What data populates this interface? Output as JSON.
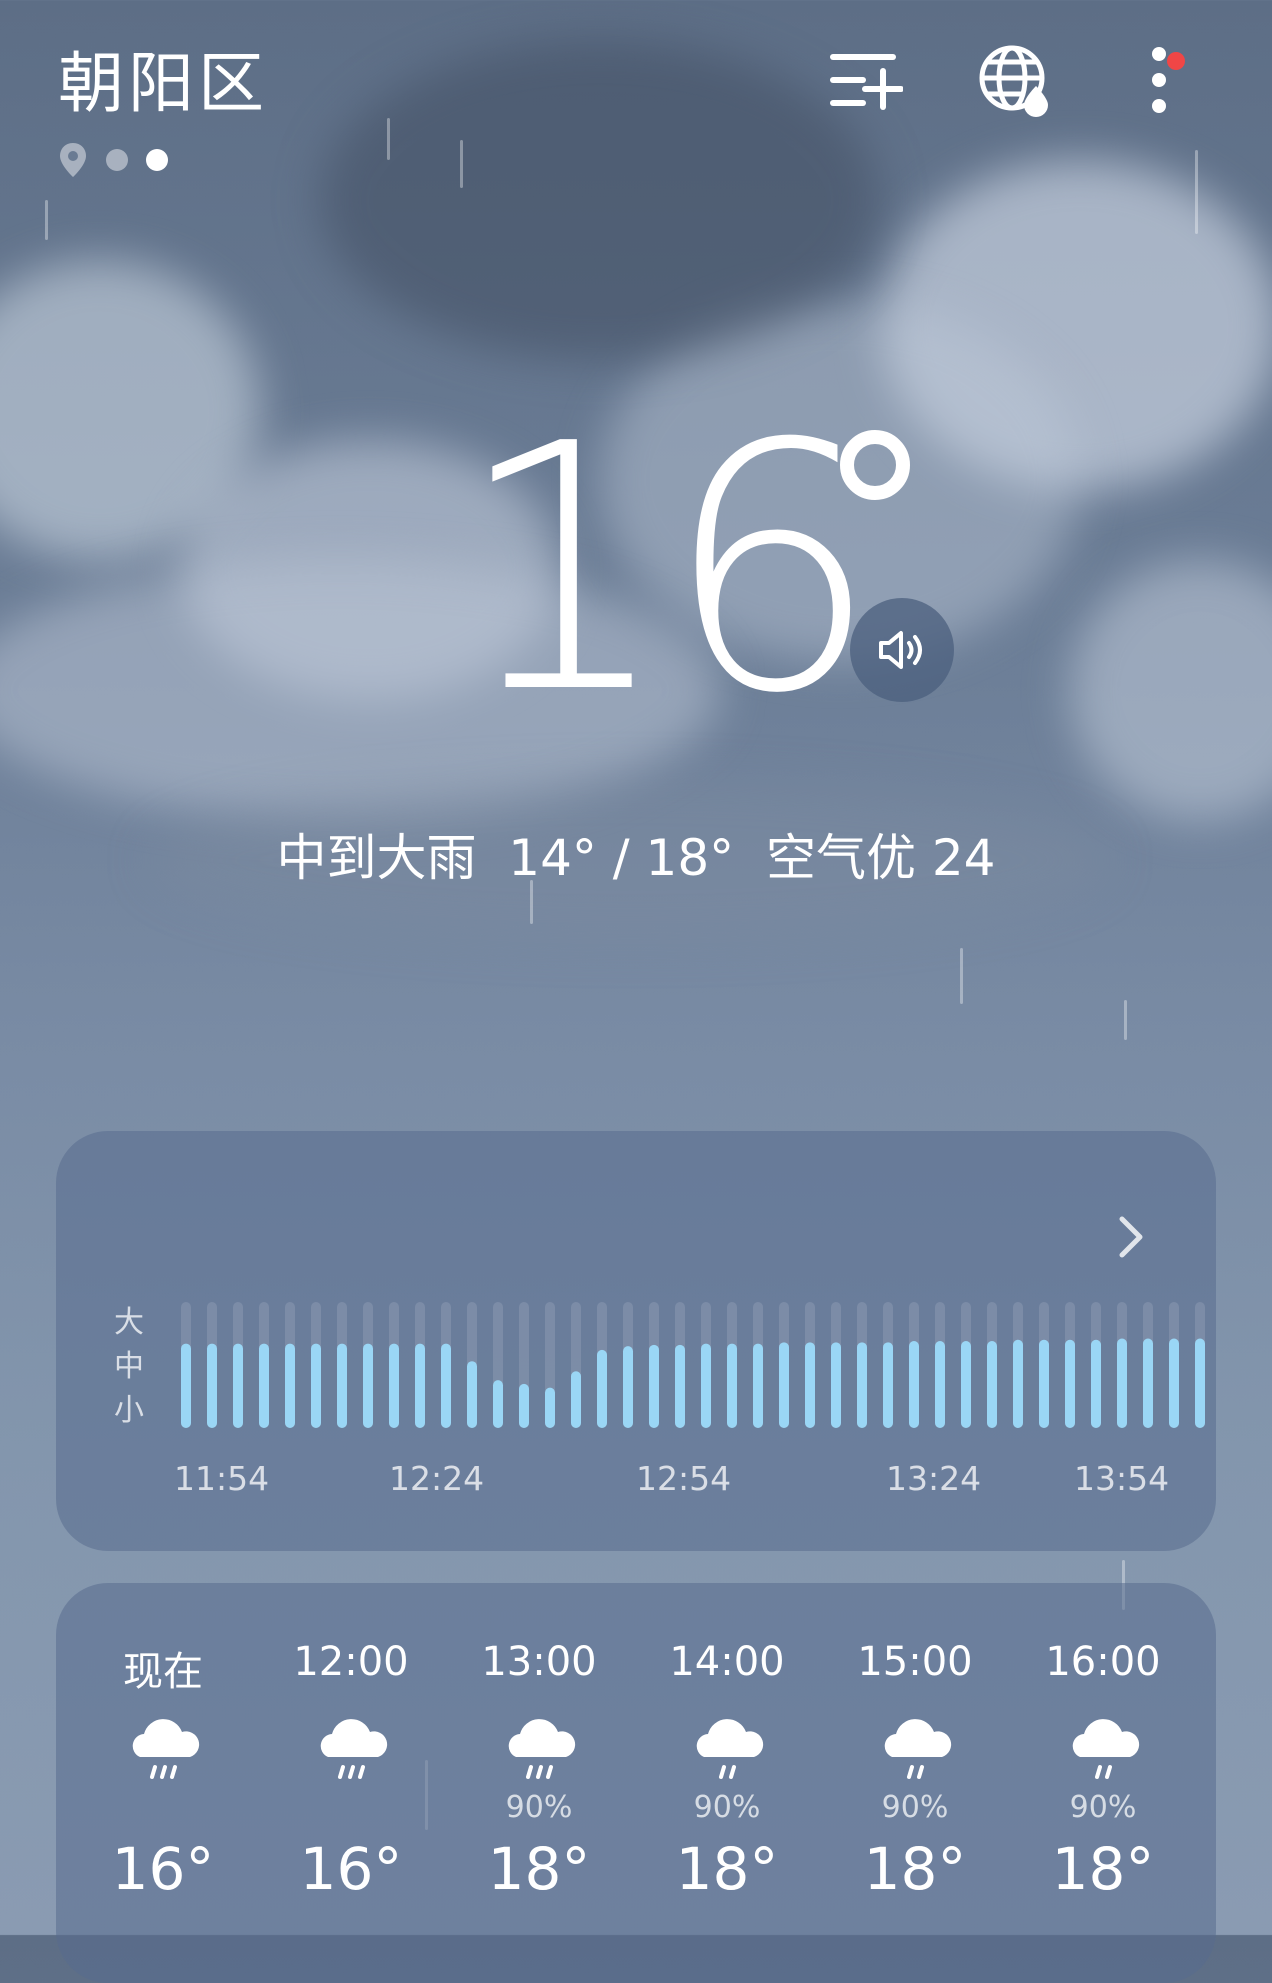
{
  "header": {
    "location": "朝阳区",
    "pages": [
      {
        "type": "location-icon"
      },
      {
        "type": "dot"
      },
      {
        "type": "dot",
        "active": true
      }
    ],
    "icons": [
      "add-city-icon",
      "globe-icon",
      "more-menu-icon"
    ],
    "notification_color": "#f04646"
  },
  "current": {
    "temperature": "16",
    "condition": "中到大雨",
    "low": "14°",
    "high": "18°",
    "aqi": "空气优 24",
    "summary_sep": " / "
  },
  "precip_card": {
    "scale": [
      "大",
      "中",
      "小"
    ],
    "time_labels": [
      "11:54",
      "12:24",
      "12:54",
      "13:24",
      "13:54"
    ],
    "intensity": [
      0.67,
      0.67,
      0.67,
      0.67,
      0.67,
      0.67,
      0.67,
      0.67,
      0.67,
      0.67,
      0.67,
      0.53,
      0.38,
      0.35,
      0.32,
      0.45,
      0.62,
      0.65,
      0.66,
      0.66,
      0.67,
      0.67,
      0.67,
      0.68,
      0.68,
      0.68,
      0.68,
      0.68,
      0.69,
      0.69,
      0.69,
      0.69,
      0.7,
      0.7,
      0.7,
      0.7,
      0.71,
      0.71,
      0.71,
      0.71
    ],
    "bar_color": "#9ad6f5"
  },
  "hourly": [
    {
      "time": "现在",
      "prob": "",
      "temp": "16°",
      "icon": "rain-cloud-icon"
    },
    {
      "time": "12:00",
      "prob": "",
      "temp": "16°",
      "icon": "rain-cloud-icon"
    },
    {
      "time": "13:00",
      "prob": "90%",
      "temp": "18°",
      "icon": "rain-cloud-icon"
    },
    {
      "time": "14:00",
      "prob": "90%",
      "temp": "18°",
      "icon": "rain-cloud-icon"
    },
    {
      "time": "15:00",
      "prob": "90%",
      "temp": "18°",
      "icon": "rain-cloud-icon"
    },
    {
      "time": "16:00",
      "prob": "90%",
      "temp": "18°",
      "icon": "rain-cloud-icon"
    }
  ]
}
